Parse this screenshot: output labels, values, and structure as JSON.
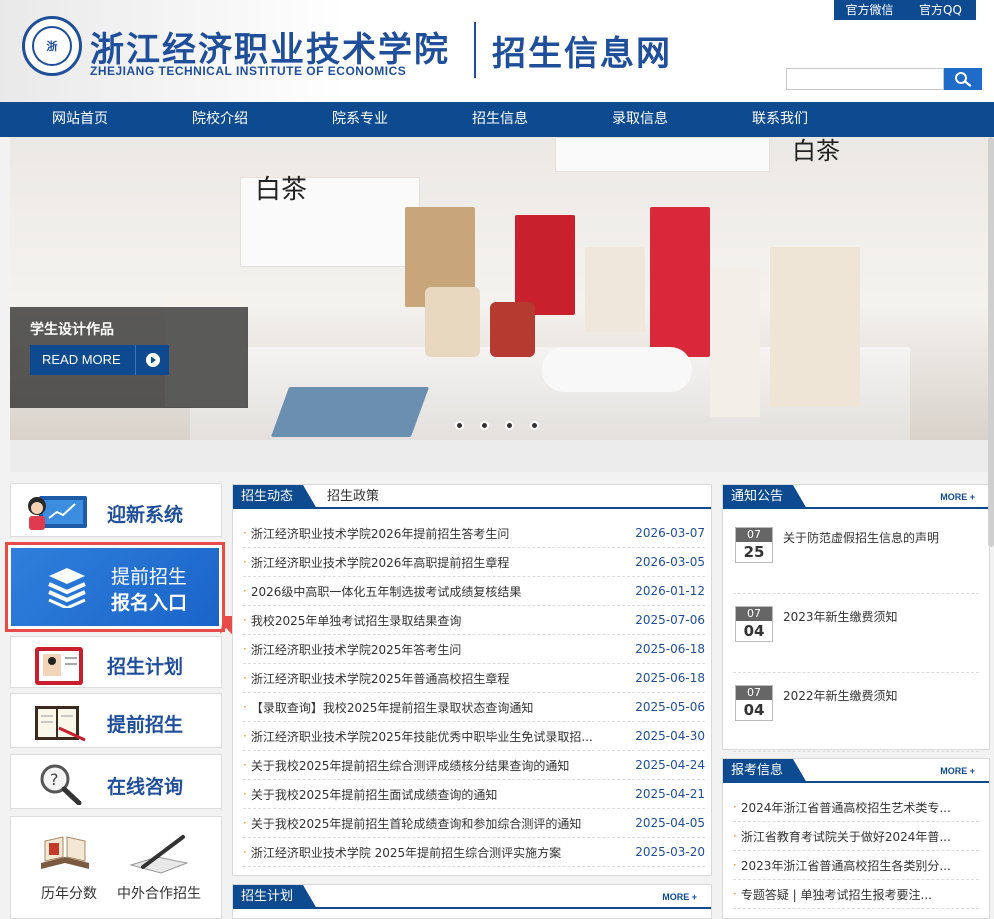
{
  "header": {
    "school_name_cn": "浙江经济职业技术学院",
    "school_name_en": "ZHEJIANG TECHNICAL INSTITUTE OF ECONOMICS",
    "site_name": "招生信息网",
    "top_links": [
      "官方微信",
      "官方QQ"
    ],
    "search_placeholder": ""
  },
  "nav": {
    "items": [
      "网站首页",
      "院校介绍",
      "院系专业",
      "招生信息",
      "录取信息",
      "联系我们"
    ]
  },
  "banner": {
    "caption": "学生设计作品",
    "read_more": "READ MORE",
    "slide_count": 4,
    "product_text": "白茶"
  },
  "sidebar": {
    "welcome": "迎新系统",
    "highlight_line1": "提前招生",
    "highlight_line2": "报名入口",
    "plan": "招生计划",
    "early": "提前招生",
    "consult": "在线咨询",
    "bottom_links": [
      "历年分数",
      "中外合作招生"
    ]
  },
  "news": {
    "tab_active": "招生动态",
    "tab_other": "招生政策",
    "items": [
      {
        "title": "浙江经济职业技术学院2026年提前招生答考生问",
        "date": "2026-03-07"
      },
      {
        "title": "浙江经济职业技术学院2026年高职提前招生章程",
        "date": "2026-03-05"
      },
      {
        "title": "2026级中高职一体化五年制选拔考试成绩复核结果",
        "date": "2026-01-12"
      },
      {
        "title": "我校2025年单独考试招生录取结果查询",
        "date": "2025-07-06"
      },
      {
        "title": "浙江经济职业技术学院2025年答考生问",
        "date": "2025-06-18"
      },
      {
        "title": "浙江经济职业技术学院2025年普通高校招生章程",
        "date": "2025-06-18"
      },
      {
        "title": "【录取查询】我校2025年提前招生录取状态查询通知",
        "date": "2025-05-06"
      },
      {
        "title": "浙江经济职业技术学院2025年技能优秀中职毕业生免试录取招...",
        "date": "2025-04-30"
      },
      {
        "title": "关于我校2025年提前招生综合测评成绩核分结果查询的通知",
        "date": "2025-04-24"
      },
      {
        "title": "关于我校2025年提前招生面试成绩查询的通知",
        "date": "2025-04-21"
      },
      {
        "title": "关于我校2025年提前招生首轮成绩查询和参加综合测评的通知",
        "date": "2025-04-05"
      },
      {
        "title": "浙江经济职业技术学院 2025年提前招生综合测评实施方案",
        "date": "2025-03-20"
      }
    ]
  },
  "plan_panel": {
    "title": "招生计划",
    "more": "MORE +"
  },
  "notices": {
    "title": "通知公告",
    "more": "MORE +",
    "items": [
      {
        "month": "07",
        "day": "25",
        "title": "关于防范虚假招生信息的声明"
      },
      {
        "month": "07",
        "day": "04",
        "title": "2023年新生缴费须知"
      },
      {
        "month": "07",
        "day": "04",
        "title": "2022年新生缴费须知"
      }
    ]
  },
  "exam": {
    "title": "报考信息",
    "more": "MORE +",
    "items": [
      "2024年浙江省普通高校招生艺术类专...",
      "浙江省教育考试院关于做好2024年普...",
      "2023年浙江省普通高校招生各类别分...",
      "专题答疑 | 单独考试招生报考要注..."
    ]
  },
  "colors": {
    "brand_blue": "#0d4a8f",
    "accent_blue": "#1e6cc8",
    "highlight_red": "#e94a4a",
    "date_blue": "#1f4f9a",
    "bullet_orange": "#e08a1e"
  }
}
